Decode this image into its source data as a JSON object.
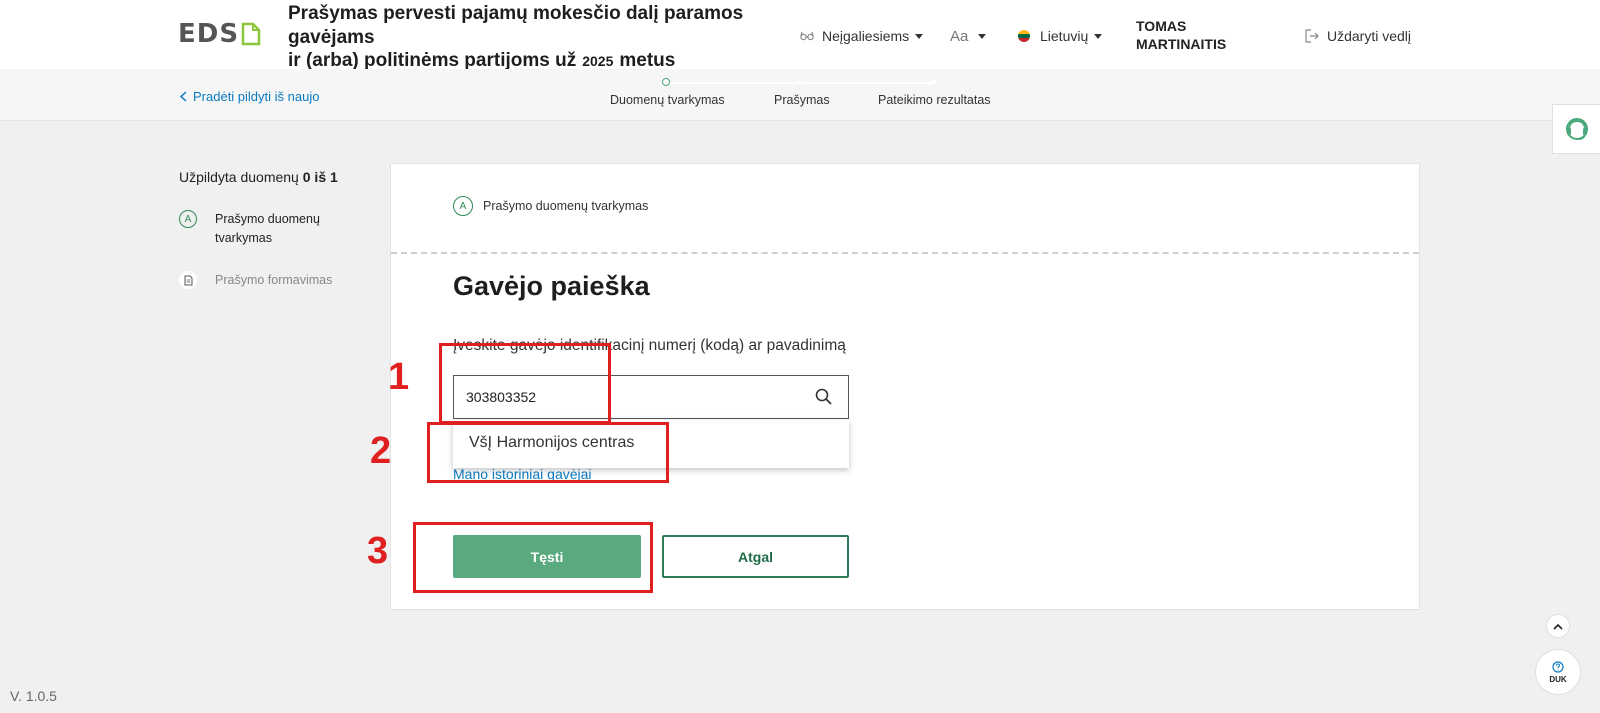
{
  "header": {
    "logo_text": "EDS",
    "title_line1": "Prašymas pervesti pajamų mokesčio dalį paramos",
    "title_line2": "gavėjams",
    "title_line3": "ir (arba) politinėms partijoms už",
    "title_year": "2025",
    "title_suffix": "metus",
    "accessibility": "Neįgaliesiems",
    "font_size": "Aa",
    "language": "Lietuvių",
    "user_first": "TOMAS",
    "user_last": "MARTINAITIS",
    "close": "Uždaryti vedlį"
  },
  "subheader": {
    "back": "Pradėti pildyti iš naujo",
    "steps": [
      "Duomenų tvarkymas",
      "Prašymas",
      "Pateikimo rezultatas"
    ]
  },
  "sidebar": {
    "progress_prefix": "Užpildyta duomenų",
    "progress_value": "0 iš 1",
    "items": [
      {
        "badge": "A",
        "label_line1": "Prašymo duomenų",
        "label_line2": "tvarkymas"
      },
      {
        "label": "Prašymo formavimas"
      }
    ]
  },
  "card": {
    "step_badge": "A",
    "step_label": "Prašymo duomenų tvarkymas",
    "heading": "Gavėjo paieška",
    "field_label": "Įveskite gavėjo identifikacinį numerį (kodą) ar pavadinimą",
    "search_value": "303803352",
    "dropdown_option": "VšĮ Harmonijos centras",
    "history_link": "Mano istoriniai gavėjai",
    "continue": "Tęsti",
    "back": "Atgal"
  },
  "annotations": [
    "1",
    "2",
    "3"
  ],
  "floating": {
    "faq": "DUK"
  },
  "version": "V. 1.0.5",
  "colors": {
    "primary": "#5aaa7f",
    "link": "#0a7bc2",
    "annotation": "#e02020",
    "accent": "#2e7d57"
  }
}
